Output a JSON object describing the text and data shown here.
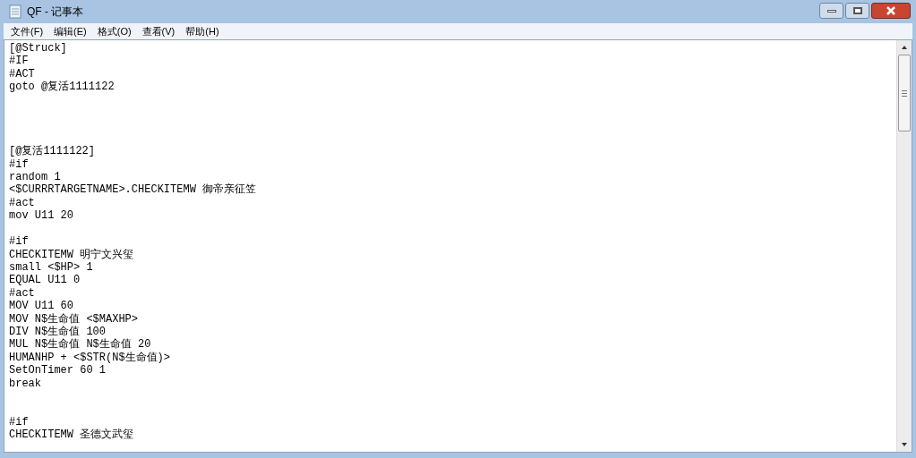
{
  "window": {
    "title": "QF - 记事本"
  },
  "menu": [
    {
      "label": "文件(F)"
    },
    {
      "label": "编辑(E)"
    },
    {
      "label": "格式(O)"
    },
    {
      "label": "查看(V)"
    },
    {
      "label": "帮助(H)"
    }
  ],
  "editor": {
    "text": "[@Struck]\n#IF\n#ACT\ngoto @复活1111122\n\n\n\n\n[@复活1111122]\n#if\nrandom 1\n<$CURRRTARGETNAME>.CHECKITEMW 御帝亲征笠\n#act\nmov U11 20\n\n#if\nCHECKITEMW 明宁文兴玺\nsmall <$HP> 1\nEQUAL U11 0\n#act\nMOV U11 60\nMOV N$生命值 <$MAXHP>\nDIV N$生命值 100\nMUL N$生命值 N$生命值 20\nHUMANHP + <$STR(N$生命值)>\nSetOnTimer 60 1\nbreak\n\n\n#if\nCHECKITEMW 圣德文武玺"
  }
}
